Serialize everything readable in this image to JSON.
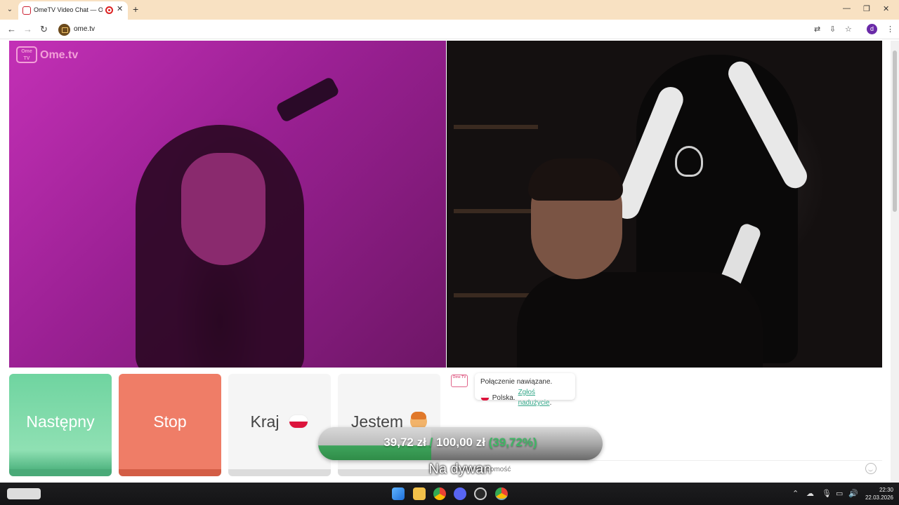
{
  "browser": {
    "tab_title": "OmeTV Video Chat — Ome",
    "url": "ome.tv",
    "profile_initial": "d"
  },
  "site": {
    "logo_box_text": "Ome TV",
    "logo_name": "Ome.tv"
  },
  "controls": {
    "next_label": "Następny",
    "stop_label": "Stop",
    "country_label": "Kraj",
    "gender_label": "Jestem"
  },
  "chat": {
    "logo_text": "Ome TV",
    "status": "Połączenie nawiązane.",
    "country": "Polska.",
    "report_link": "Zgłoś nadużycie",
    "report_suffix": ".",
    "input_placeholder": "Napisz wiadomość"
  },
  "donation": {
    "current": "39,72 zł",
    "separator": "/",
    "goal": "100,00 zł",
    "percent": "(39,72%)",
    "progress_fraction": 0.3972
  },
  "stream_subtitle": "Na dywan",
  "taskbar": {
    "time": "22:30",
    "date": "22.03.2026"
  },
  "colors": {
    "next_button": "#6fd4a0",
    "stop_button": "#ef7d67",
    "accent_link": "#35a88a",
    "poland_red": "#dc143c"
  }
}
